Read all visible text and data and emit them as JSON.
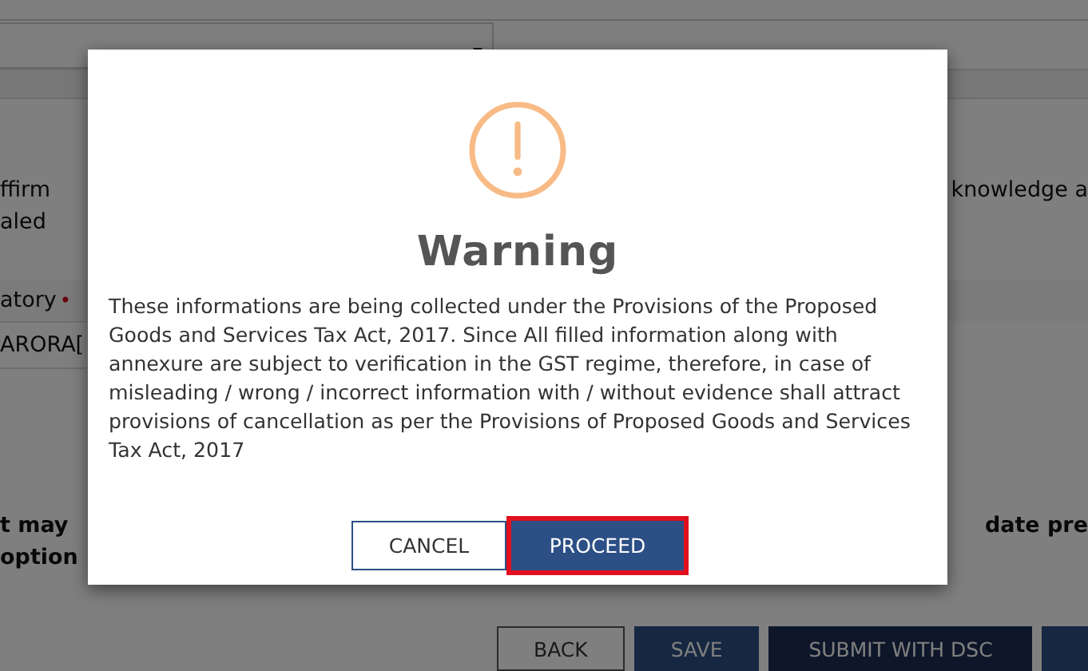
{
  "background_page": {
    "declaration_left": [
      "ffirm",
      "aled"
    ],
    "declaration_right": "knowledge a",
    "signatory_label": "atory",
    "required_mark": "•",
    "signatory_value": "ARORA[",
    "note_left": [
      "t may",
      "option"
    ],
    "note_right": "date pre",
    "buttons": [
      {
        "label": "BACK",
        "kind": "outline"
      },
      {
        "label": "SAVE",
        "kind": "primary"
      },
      {
        "label": "SUBMIT WITH DSC",
        "kind": "dark"
      },
      {
        "kind": "primary"
      }
    ]
  },
  "dialog": {
    "title": "Warning",
    "message": "These informations are being collected under the Provisions of the Proposed Goods and Services Tax Act, 2017. Since All filled information along with annexure are subject to verification in the GST regime, therefore, in case of misleading / wrong / incorrect information with / without evidence shall attract provisions of cancellation as per the Provisions of Proposed Goods and Services Tax Act, 2017",
    "buttons": [
      {
        "label": "CANCEL",
        "kind": "outline",
        "focused": false
      },
      {
        "label": "PROCEED",
        "kind": "primary",
        "focused": true
      }
    ]
  }
}
